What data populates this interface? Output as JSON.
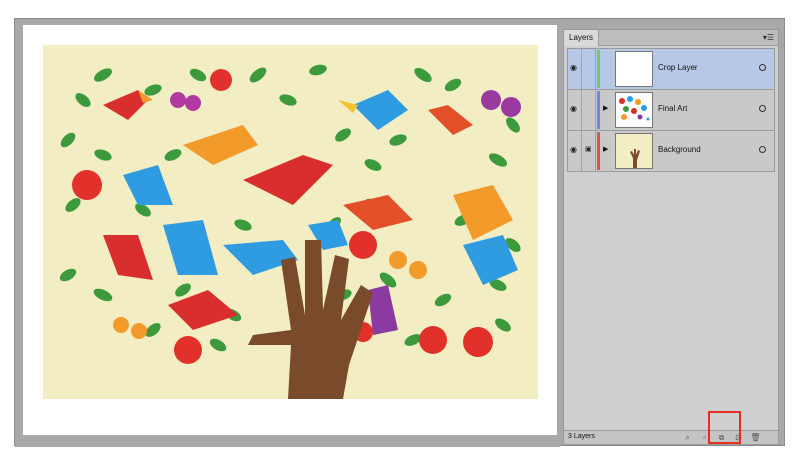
{
  "panel": {
    "tab_label": "Layers",
    "menu_icon": "menu-icon",
    "layers": [
      {
        "name": "Crop Layer",
        "color": "#6ccc6c",
        "selected": true,
        "locked": false
      },
      {
        "name": "Final Art",
        "color": "#6e86e0",
        "selected": false,
        "locked": false
      },
      {
        "name": "Background",
        "color": "#e05050",
        "selected": false,
        "locked": true
      }
    ],
    "footer": {
      "count_label": "3 Layers",
      "icons": [
        "locate-object-icon",
        "make-clipping-mask-icon",
        "create-sublayer-icon",
        "create-new-layer-icon",
        "delete-icon"
      ]
    }
  },
  "colors": {
    "canvas_bg": "#a9a9a9",
    "art_bg": "#f3edc4",
    "highlight": "#e53020"
  }
}
